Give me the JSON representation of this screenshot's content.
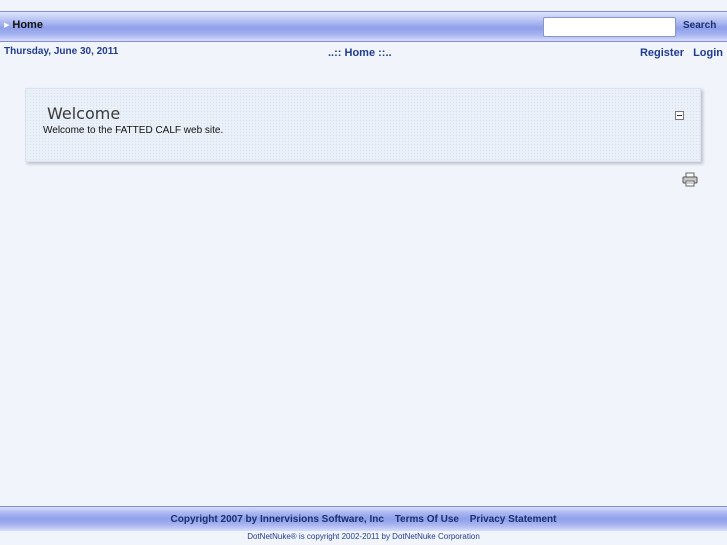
{
  "topnav": {
    "home_label": "Home"
  },
  "search": {
    "placeholder": "",
    "value": "",
    "button_label": "Search"
  },
  "header": {
    "date": "Thursday, June 30, 2011",
    "breadcrumb_prefix": "..::",
    "breadcrumb_label": "Home",
    "breadcrumb_suffix": "::..",
    "register_label": "Register",
    "login_label": "Login"
  },
  "module": {
    "title": "Welcome",
    "body": "Welcome to the FATTED CALF web site.",
    "collapse_icon": "minus-box-icon",
    "print_icon": "printer-icon"
  },
  "footer": {
    "copyright": "Copyright 2007 by Innervisions Software, Inc",
    "terms_label": "Terms Of Use",
    "privacy_label": "Privacy Statement",
    "dnn_notice": "DotNetNuke® is copyright 2002-2011 by DotNetNuke Corporation"
  },
  "colors": {
    "background": "#f2f4fb",
    "nav_bar": "#8f9fea",
    "link": "#1f3d8f"
  }
}
